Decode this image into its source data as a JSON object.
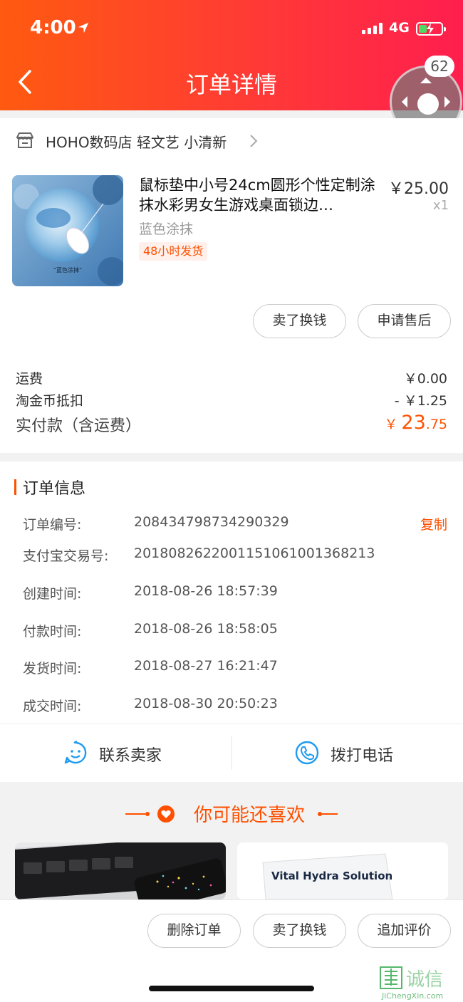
{
  "status_bar": {
    "time": "4:00",
    "network": "4G"
  },
  "header": {
    "title": "订单详情",
    "float_badge": "62"
  },
  "store": {
    "name": "HOHO数码店 轻文艺 小清新"
  },
  "product": {
    "title": "鼠标垫中小号24cm圆形个性定制涂抹水彩男女生游戏桌面锁边…",
    "price": "￥25.00",
    "qty": "x1",
    "variant": "蓝色涂抹",
    "ship_tag": "48小时发货",
    "image_caption": "“蓝色涂抹”"
  },
  "item_actions": {
    "sell": "卖了换钱",
    "after_sale": "申请售后"
  },
  "fees": {
    "shipping_label": "运费",
    "shipping_value": "￥0.00",
    "coin_label": "淘金币抵扣",
    "coin_value": "- ￥1.25",
    "total_label": "实付款（含运费）",
    "total_currency": "￥",
    "total_int": "23",
    "total_dec": ".75"
  },
  "order_info": {
    "title": "订单信息",
    "copy": "复制",
    "rows": [
      {
        "label": "订单编号:",
        "value": "208434798734290329"
      },
      {
        "label": "支付宝交易号:",
        "value": "2018082622001151061001368213"
      },
      {
        "label": "创建时间:",
        "value": "2018-08-26 18:57:39"
      },
      {
        "label": "付款时间:",
        "value": "2018-08-26 18:58:05"
      },
      {
        "label": "发货时间:",
        "value": "2018-08-27 16:21:47"
      },
      {
        "label": "成交时间:",
        "value": "2018-08-30 20:50:23"
      }
    ]
  },
  "contact": {
    "seller": "联系卖家",
    "phone": "拨打电话"
  },
  "recommend": {
    "title": "你可能还喜欢",
    "tile2_text": "Vital Hydra Solution"
  },
  "bottom_actions": {
    "delete": "删除订单",
    "sell": "卖了换钱",
    "review": "追加评价"
  },
  "watermark": {
    "text": "诚信",
    "url": "JiChengXin.com"
  },
  "colors": {
    "accent": "#ff5000",
    "header_start": "#ff5a10",
    "header_end": "#ff1e4e"
  }
}
